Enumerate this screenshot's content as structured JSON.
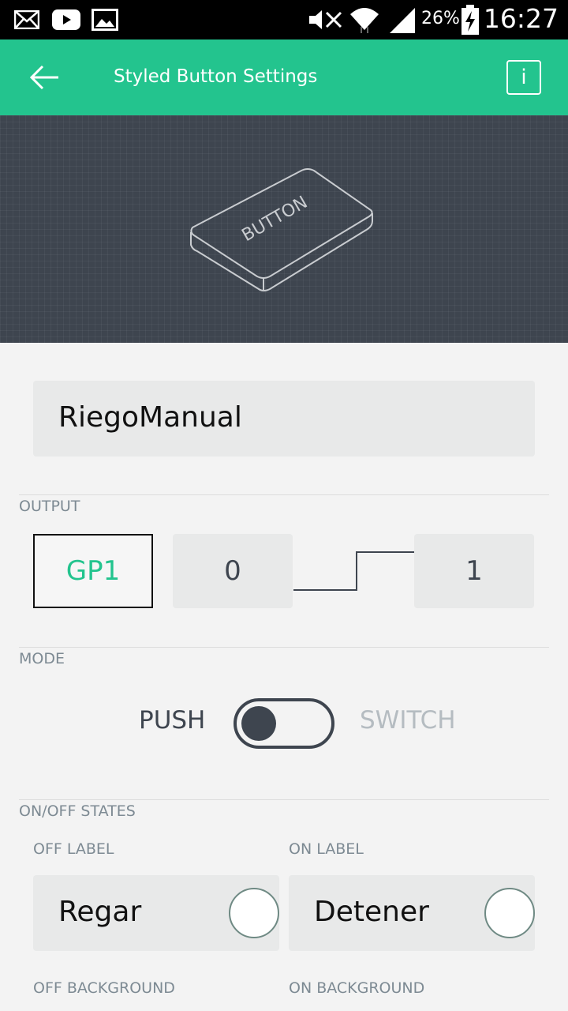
{
  "status_bar": {
    "battery_percent": "26%",
    "time": "16:27",
    "icons": [
      "mail-icon",
      "youtube-icon",
      "image-icon",
      "mute-icon",
      "wifi-icon",
      "signal-icon",
      "battery-charging-icon"
    ]
  },
  "app_bar": {
    "title": "Styled Button Settings",
    "info_label": "i",
    "background_color": "#23c48e"
  },
  "hero": {
    "button_text": "BUTTON"
  },
  "widget": {
    "name": "RiegoManual"
  },
  "output": {
    "section_label": "OUTPUT",
    "pin": "GP1",
    "low_value": "0",
    "high_value": "1"
  },
  "mode": {
    "section_label": "MODE",
    "push_label": "PUSH",
    "switch_label": "SWITCH",
    "selected": "PUSH"
  },
  "states": {
    "section_label": "ON/OFF STATES",
    "off_label_title": "OFF LABEL",
    "on_label_title": "ON LABEL",
    "off_label_value": "Regar",
    "on_label_value": "Detener",
    "off_background_title": "OFF BACKGROUND",
    "on_background_title": "ON BACKGROUND"
  },
  "colors": {
    "accent": "#23c48e",
    "dark": "#3e454f",
    "field": "#e8e9e9"
  }
}
